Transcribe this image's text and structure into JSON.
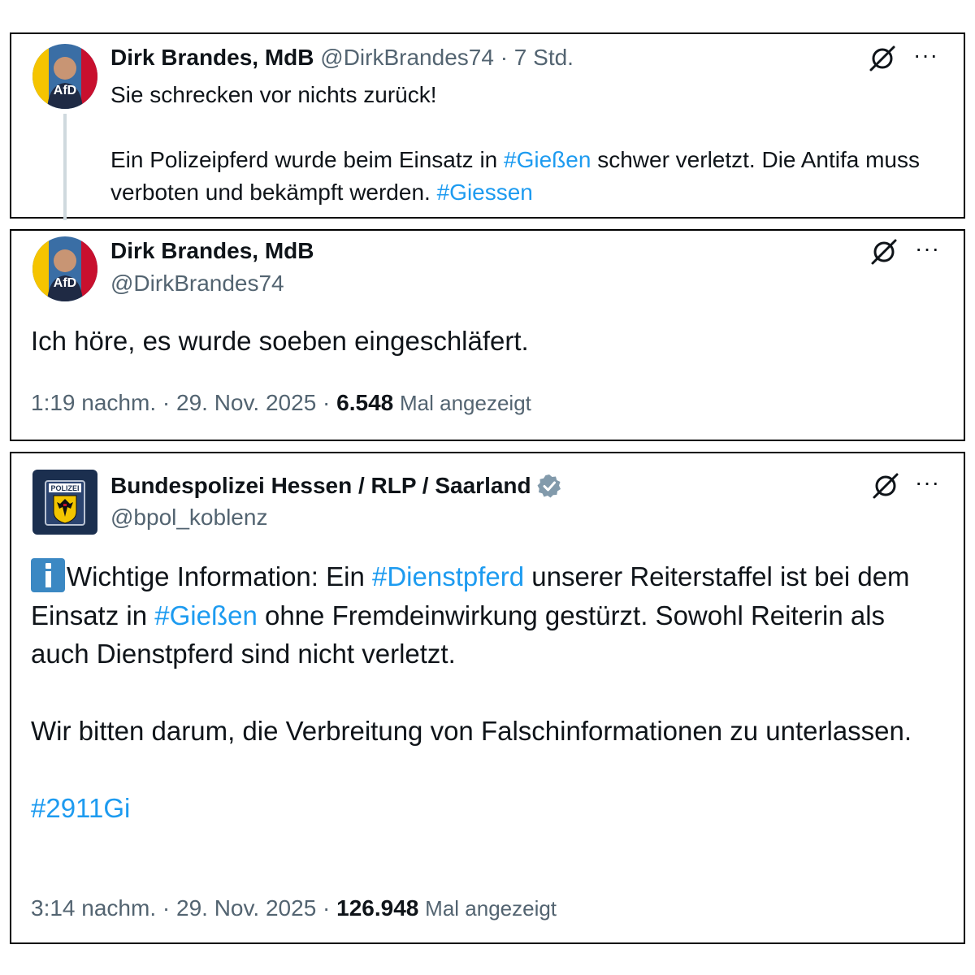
{
  "tweets": [
    {
      "display_name": "Dirk Brandes, MdB",
      "handle": "@DirkBrandes74",
      "separator": "·",
      "time": "7 Std.",
      "avatar_text": "AfD",
      "text": {
        "line1": "Sie schrecken vor nichts zurück!",
        "p2_a": "Ein Polizeipferd wurde beim Einsatz in ",
        "p2_tag1": "#Gießen",
        "p2_b": " schwer verletzt. Die Antifa muss verboten und bekämpft werden. ",
        "p2_tag2": "#Giessen"
      }
    },
    {
      "display_name": "Dirk Brandes, MdB",
      "handle": "@DirkBrandes74",
      "avatar_text": "AfD",
      "text": "Ich höre, es wurde soeben eingeschläfert.",
      "time": "1:19 nachm.",
      "separator": "·",
      "date": "29. Nov. 2025",
      "views_count": "6.548",
      "views_label": "Mal angezeigt"
    },
    {
      "display_name": "Bundespolizei Hessen / RLP / Saarland",
      "handle": "@bpol_koblenz",
      "logo_text": "POLIZEI",
      "text": {
        "p1_a": "Wichtige Information: Ein ",
        "p1_tag1": "#Dienstpferd",
        "p1_b": " unserer Reiterstaffel ist bei dem Einsatz in ",
        "p1_tag2": "#Gießen",
        "p1_c": " ohne Fremdeinwirkung gestürzt. Sowohl Reiterin als auch Dienstpferd sind nicht verletzt.",
        "p2": "Wir bitten darum, die Verbreitung von Falschinformationen zu unterlassen.",
        "p3_tag": "#2911Gi"
      },
      "time": "3:14 nachm.",
      "separator": "·",
      "date": "29. Nov. 2025",
      "views_count": "126.948",
      "views_label": "Mal angezeigt"
    }
  ],
  "icons": {
    "grok": "grok-icon",
    "more": "more-icon",
    "verified": "verified-badge-icon",
    "info": "information-emoji-icon"
  },
  "more_glyph": "···",
  "colors": {
    "hashtag": "#1d9bf0",
    "muted": "#536471",
    "text": "#0f1419",
    "verified_grey": "#829aab",
    "border": "#000000"
  }
}
